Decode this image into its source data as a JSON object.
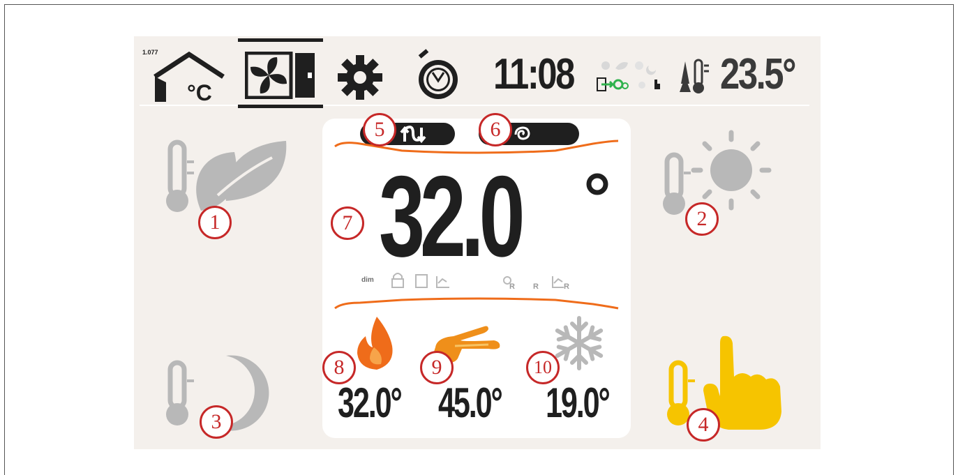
{
  "header": {
    "tiny_value": "1.077",
    "unit_label": "°C",
    "clock": "11:08",
    "room_temperature": "23.5°"
  },
  "main": {
    "setpoint": "32.0",
    "setpoint_degree": "°"
  },
  "readings": [
    {
      "name": "heating",
      "value": "32.0°"
    },
    {
      "name": "hot-water",
      "value": "45.0°"
    },
    {
      "name": "cooling",
      "value": "19.0°"
    }
  ],
  "status_icons": {
    "dim_label": "dim"
  },
  "markers": [
    "1",
    "2",
    "3",
    "4",
    "5",
    "6",
    "7",
    "8",
    "9",
    "10"
  ],
  "colors": {
    "accent_orange": "#ef6c1a",
    "marker_red": "#c62828",
    "manual_yellow": "#f6c400",
    "icon_gray": "#b8b8b8",
    "dark": "#1f1f1f"
  }
}
